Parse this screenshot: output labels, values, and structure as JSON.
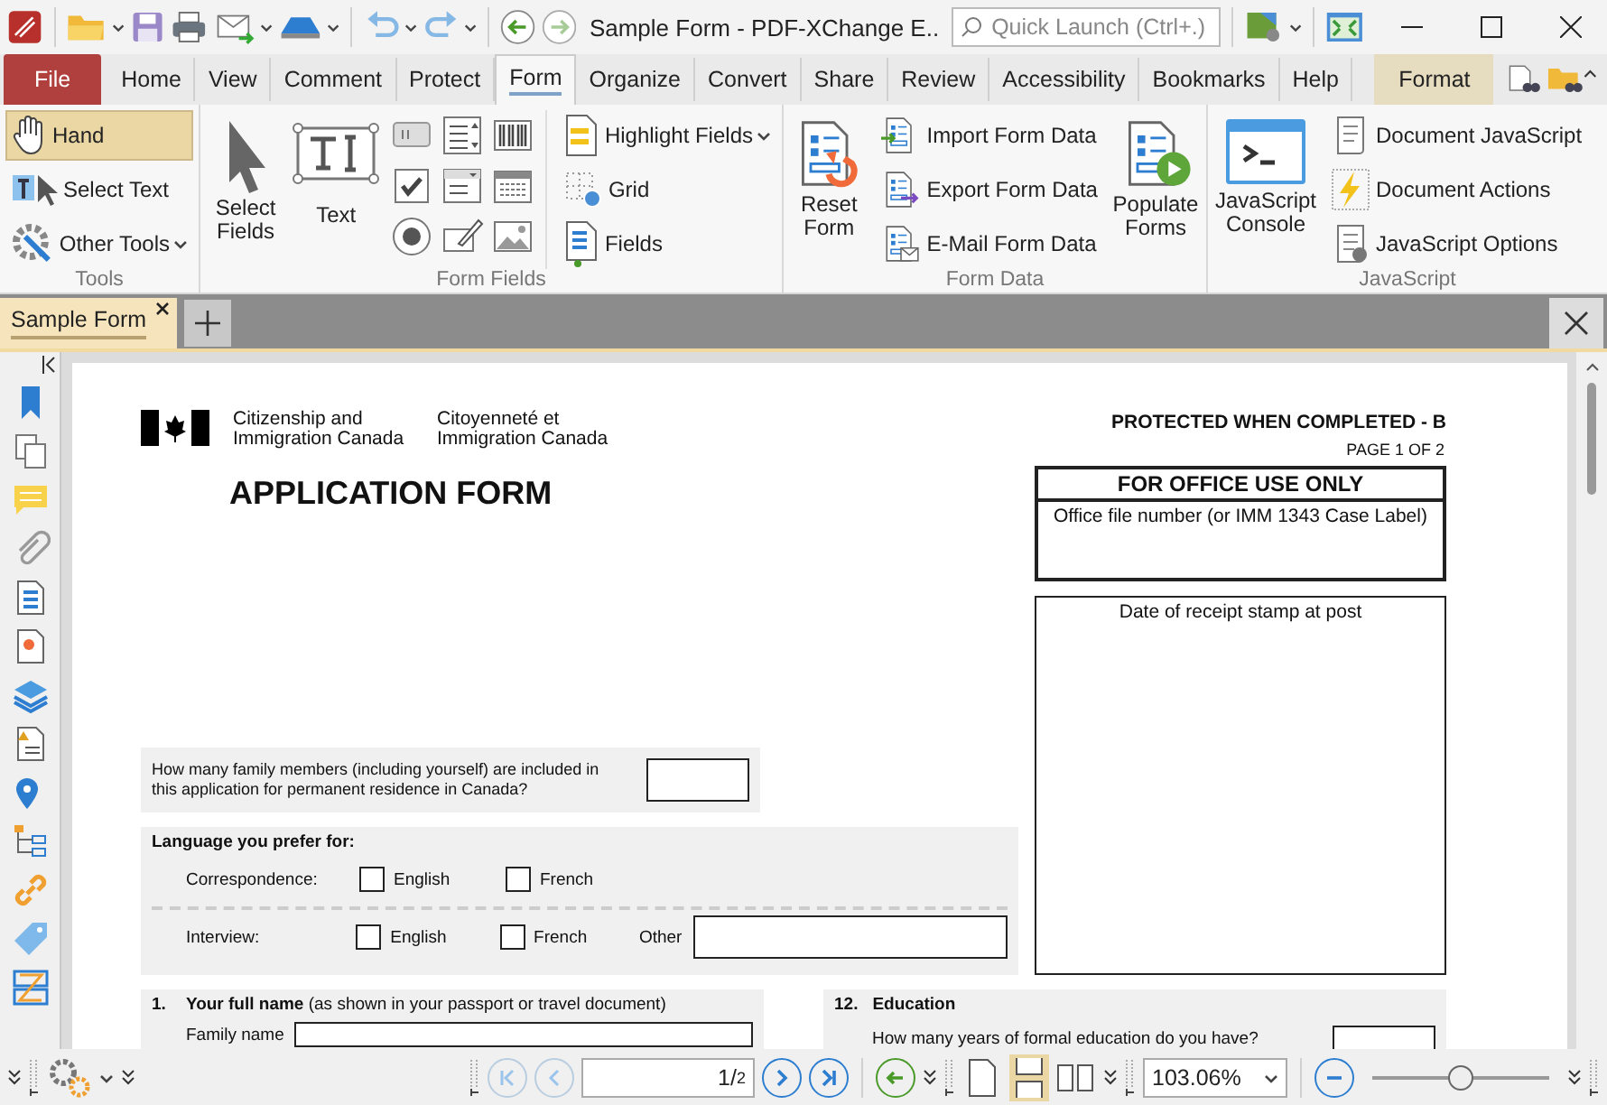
{
  "window": {
    "title": "Sample Form - PDF-XChange E..",
    "search": {
      "placeholder": "Quick Launch (Ctrl+.)"
    }
  },
  "ribbon_tabs": [
    {
      "label": "File",
      "kind": "file",
      "selected": false
    },
    {
      "label": "Home",
      "kind": "tab",
      "selected": false
    },
    {
      "label": "View",
      "kind": "tab",
      "selected": false
    },
    {
      "label": "Comment",
      "kind": "tab",
      "selected": false
    },
    {
      "label": "Protect",
      "kind": "tab",
      "selected": false
    },
    {
      "label": "Form",
      "kind": "tab",
      "selected": true
    },
    {
      "label": "Organize",
      "kind": "tab",
      "selected": false
    },
    {
      "label": "Convert",
      "kind": "tab",
      "selected": false
    },
    {
      "label": "Share",
      "kind": "tab",
      "selected": false
    },
    {
      "label": "Review",
      "kind": "tab",
      "selected": false
    },
    {
      "label": "Accessibility",
      "kind": "tab",
      "selected": false
    },
    {
      "label": "Bookmarks",
      "kind": "tab",
      "selected": false
    },
    {
      "label": "Help",
      "kind": "tab",
      "selected": false
    },
    {
      "label": "Format",
      "kind": "contextual",
      "selected": false
    }
  ],
  "ribbon": {
    "tools": {
      "label": "Tools",
      "items": [
        {
          "label": "Hand",
          "selected": true
        },
        {
          "label": "Select Text",
          "selected": false
        },
        {
          "label": "Other Tools",
          "selected": false
        }
      ]
    },
    "form_fields": {
      "label": "Form Fields",
      "select_fields": "Select Fields",
      "text": "Text",
      "highlight_fields": "Highlight Fields",
      "grid": "Grid",
      "fields": "Fields"
    },
    "form_data": {
      "label": "Form Data",
      "reset_form": "Reset Form",
      "items": [
        "Import Form Data",
        "Export Form Data",
        "E-Mail Form Data"
      ],
      "populate_forms": "Populate Forms"
    },
    "javascript": {
      "label": "JavaScript",
      "console": "JavaScript Console",
      "items": [
        "Document JavaScript",
        "Document Actions",
        "JavaScript Options"
      ]
    }
  },
  "document_tabs": [
    {
      "label": "Sample Form",
      "selected": true
    }
  ],
  "page": {
    "agency_en": [
      "Citizenship and",
      "Immigration Canada"
    ],
    "agency_fr": [
      "Citoyenneté et",
      "Immigration Canada"
    ],
    "protected": "PROTECTED WHEN COMPLETED - B",
    "page_label": "PAGE 1 OF 2",
    "title": "APPLICATION FORM",
    "office_box": {
      "heading": "FOR OFFICE USE ONLY",
      "label": "Office file number (or IMM 1343 Case Label)"
    },
    "receipt_box": {
      "label": "Date of receipt stamp at post"
    },
    "family_question": "How many family members (including yourself) are included in this application for permanent residence in Canada?",
    "language": {
      "heading": "Language you prefer for:",
      "rows": [
        {
          "label": "Correspondence:",
          "options": [
            {
              "label": "English",
              "checked": false
            },
            {
              "label": "French",
              "checked": false
            }
          ]
        },
        {
          "label": "Interview:",
          "options": [
            {
              "label": "English",
              "checked": false
            },
            {
              "label": "French",
              "checked": false
            }
          ],
          "other_label": "Other"
        }
      ]
    },
    "full_name": {
      "number": "1.",
      "heading": "**Your full name** (as shown in your passport or travel document)",
      "field_label": "Family name"
    },
    "education": {
      "number": "12.",
      "heading": "Education",
      "question": "How many years of formal education do you have?"
    }
  },
  "status_bar": {
    "page_field": "1",
    "page_separator": "/",
    "page_count": "2",
    "zoom": "103.06%",
    "zoom_slider": {
      "level": 0.5
    }
  }
}
